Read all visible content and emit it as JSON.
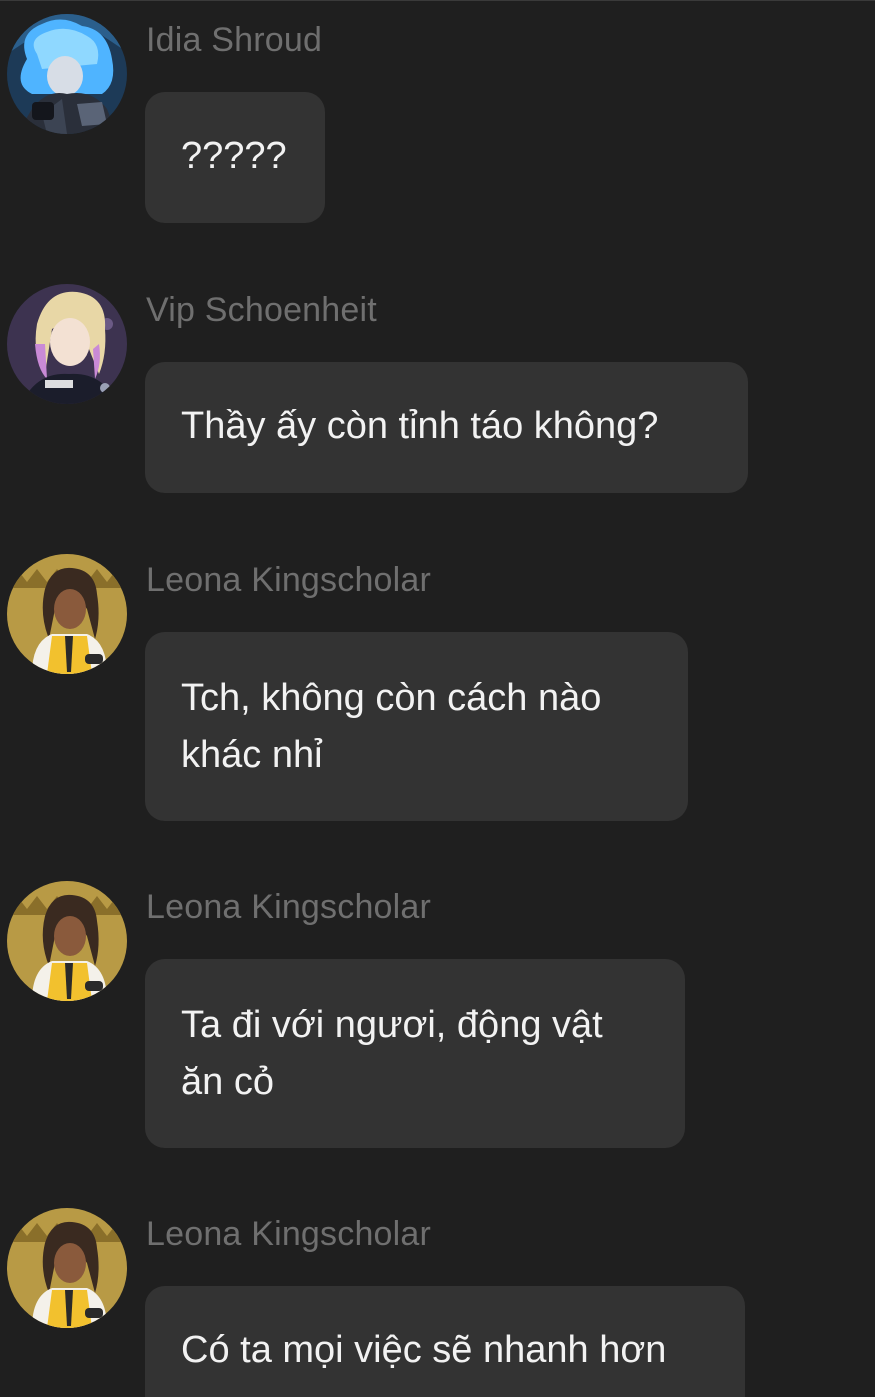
{
  "colors": {
    "background": "#1f1f1f",
    "bubble": "#333333",
    "name_text": "#6f6f6f",
    "message_text": "#f2f2f2"
  },
  "messages": [
    {
      "sender": "Idia Shroud",
      "avatar_icon": "idia-avatar",
      "lines": [
        "?????"
      ]
    },
    {
      "sender": "Vip Schoenheit",
      "avatar_icon": "vil-avatar",
      "lines": [
        "Thầy ấy còn tỉnh táo không?"
      ]
    },
    {
      "sender": "Leona Kingscholar",
      "avatar_icon": "leona-avatar",
      "lines": [
        "Tch, không còn cách nào",
        "khác nhỉ"
      ]
    },
    {
      "sender": "Leona Kingscholar",
      "avatar_icon": "leona-avatar",
      "lines": [
        "Ta đi với ngươi, động vật",
        "ăn cỏ"
      ]
    },
    {
      "sender": "Leona Kingscholar",
      "avatar_icon": "leona-avatar",
      "lines": [
        "Có ta mọi việc sẽ nhanh hơn"
      ]
    }
  ]
}
